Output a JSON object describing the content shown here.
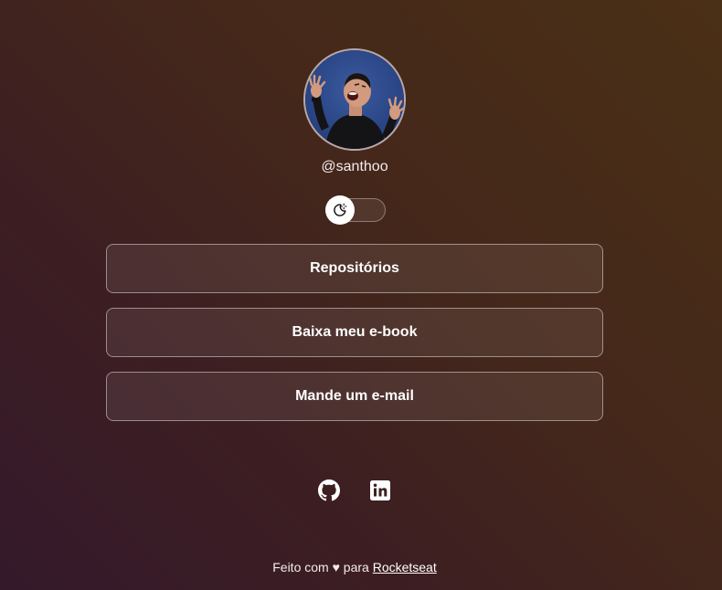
{
  "profile": {
    "username": "@santhoo",
    "avatar_alt": "avatar-photo"
  },
  "theme_switch": {
    "icon": "moon-sun-icon",
    "state": "dark"
  },
  "links": [
    {
      "label": "Repositórios"
    },
    {
      "label": "Baixa meu e-book"
    },
    {
      "label": "Mande um e-mail"
    }
  ],
  "socials": [
    {
      "icon": "github-icon"
    },
    {
      "icon": "linkedin-icon"
    }
  ],
  "footer": {
    "prefix": "Feito com ♥ para ",
    "link_label": "Rocketseat"
  },
  "colors": {
    "bg_start": "#4a3016",
    "bg_end": "#34192b",
    "button_border": "rgba(255,255,255,0.45)",
    "text": "#ffffff"
  }
}
